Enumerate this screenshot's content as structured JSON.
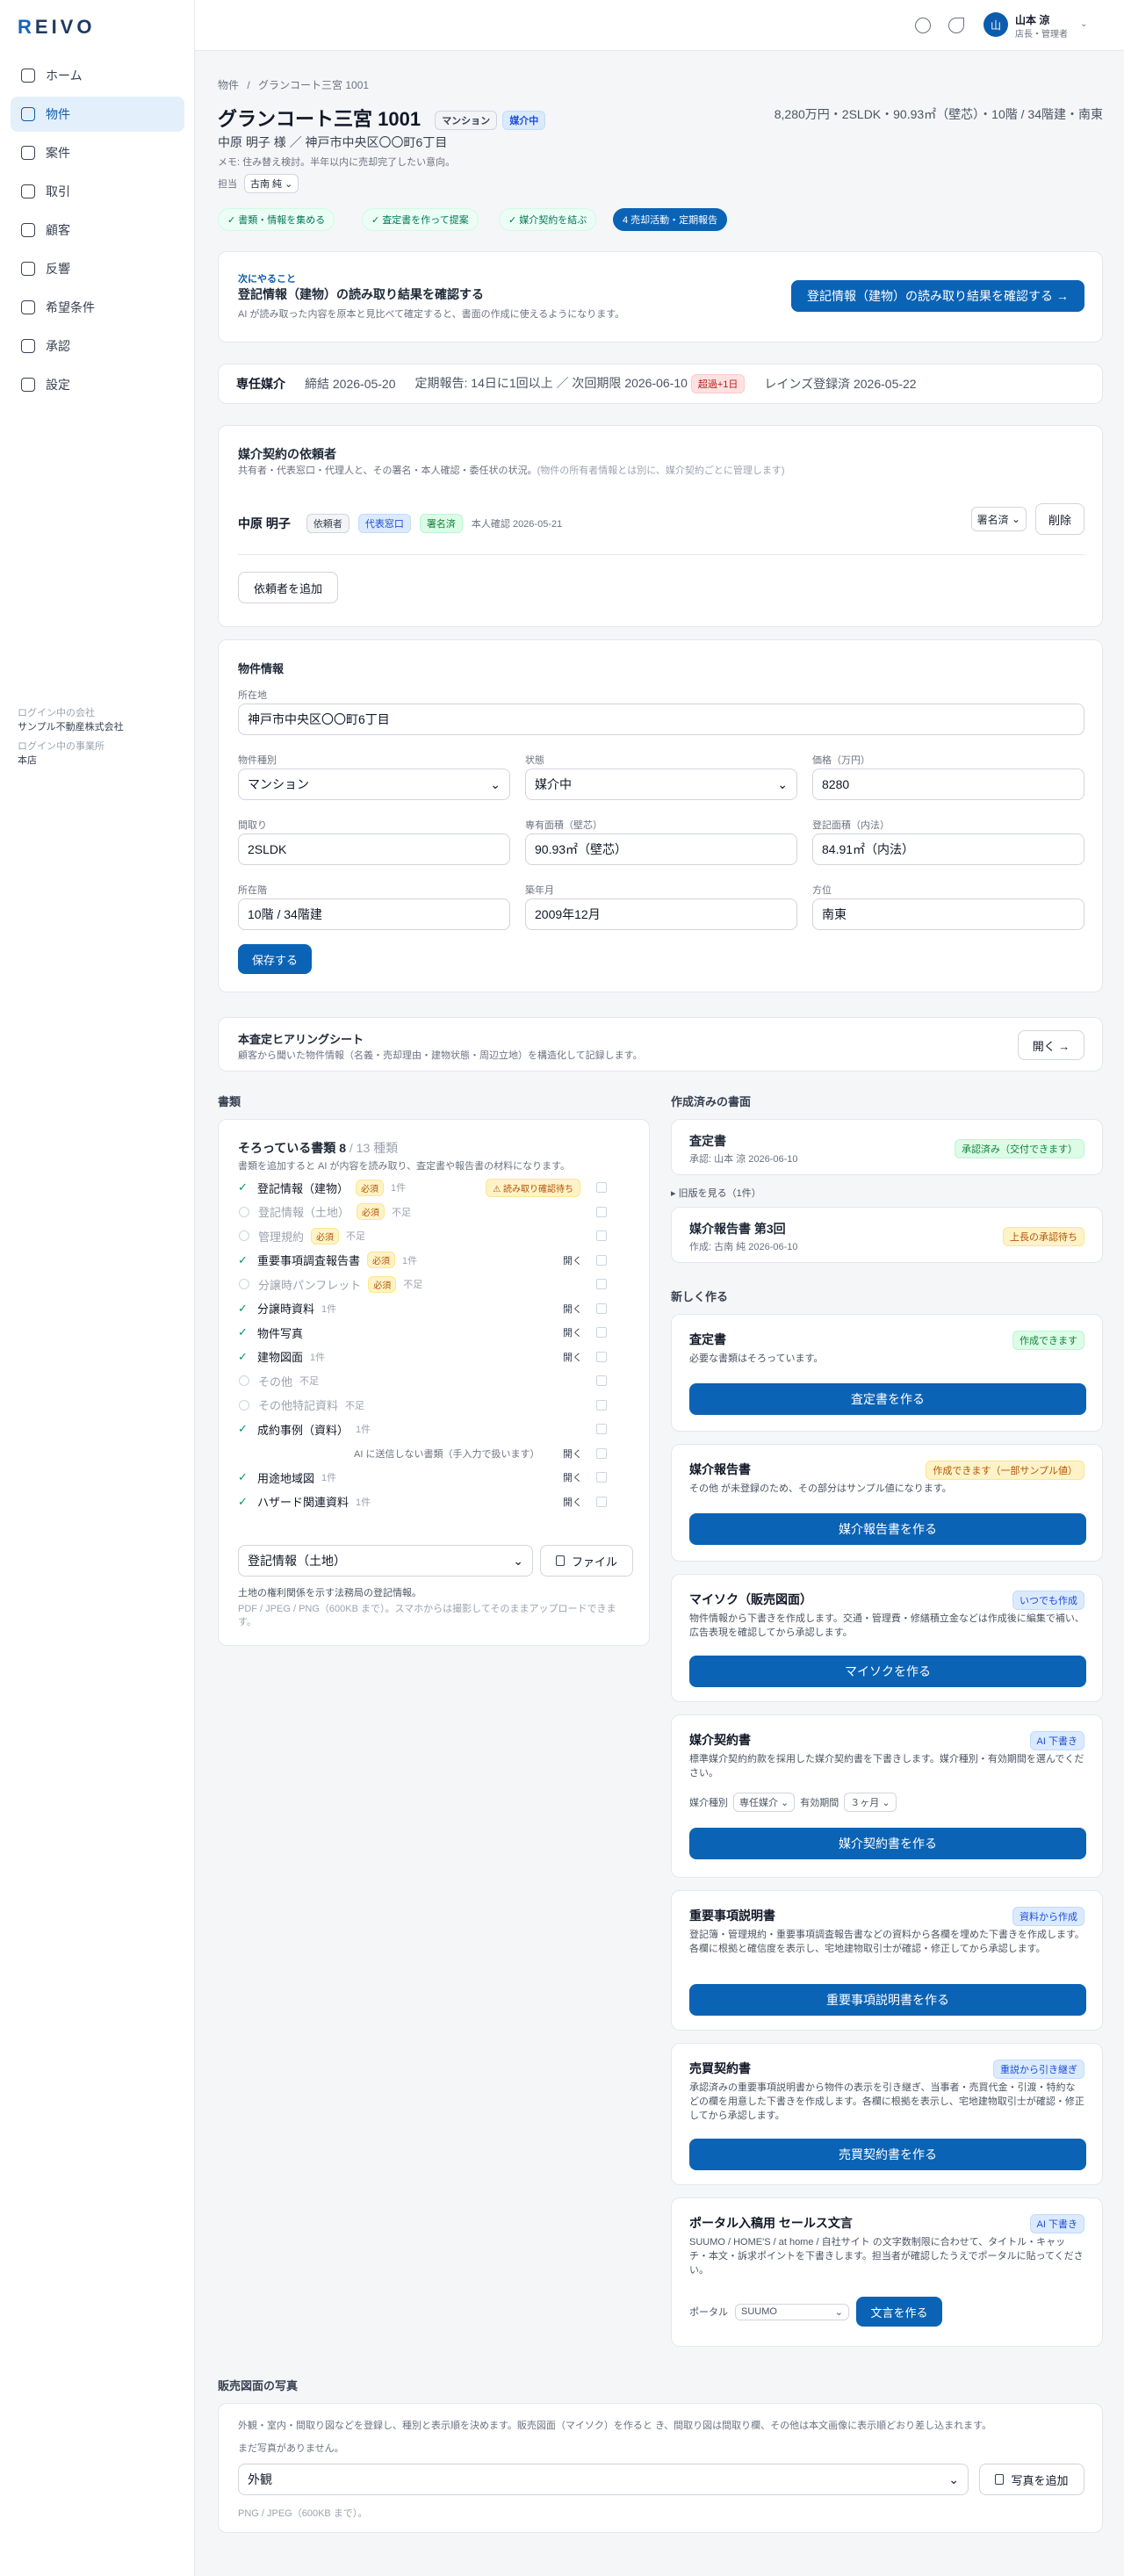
{
  "app": {
    "logo": "REIVO"
  },
  "sidebar": {
    "items": [
      {
        "label": "ホーム",
        "icon": "home-icon"
      },
      {
        "label": "物件",
        "icon": "building-icon",
        "active": true
      },
      {
        "label": "案件",
        "icon": "briefcase-icon"
      },
      {
        "label": "取引",
        "icon": "document-icon"
      },
      {
        "label": "顧客",
        "icon": "users-icon"
      },
      {
        "label": "反響",
        "icon": "inbox-icon"
      },
      {
        "label": "希望条件",
        "icon": "target-icon"
      },
      {
        "label": "承認",
        "icon": "check-square-icon"
      },
      {
        "label": "設定",
        "icon": "gear-icon"
      }
    ],
    "company_label": "ログイン中の会社",
    "company": "サンプル不動産株式会社",
    "office_label": "ログイン中の事業所",
    "office": "本店"
  },
  "user": {
    "initial": "山",
    "name": "山本 涼",
    "role": "店長・管理者"
  },
  "breadcrumb": {
    "root": "物件",
    "sep": "/",
    "current": "グランコート三宮 1001"
  },
  "property": {
    "name": "グランコート三宮 1001",
    "type_tag": "マンション",
    "status_tag": "媒介中",
    "summary": "8,280万円・2SLDK・90.93㎡（壁芯）・10階 / 34階建・南東",
    "owner_line": "中原 明子 様 ／ 神戸市中央区〇〇町6丁目",
    "memo": "メモ: 住み替え検討。半年以内に売却完了したい意向。",
    "assignee_label": "担当",
    "assignee": "古南 純"
  },
  "steps": [
    "✓ 書類・情報を集める",
    "✓ 査定書を作って提案",
    "✓ 媒介契約を結ぶ",
    "4 売却活動・定期報告"
  ],
  "next": {
    "label": "次にやること",
    "title": "登記情報（建物）の読み取り結果を確認する",
    "desc": "AI が読み取った内容を原本と見比べて確定すると、書面の作成に使えるようになります。",
    "button": "登記情報（建物）の読み取り結果を確認する →"
  },
  "mediation": {
    "type": "専任媒介",
    "signed": "締結 2026-05-20",
    "report": "定期報告: 14日に1回以上 ／ 次回期限 2026-06-10",
    "overdue": "超過+1日",
    "reins": "レインズ登録済 2026-05-22"
  },
  "clients": {
    "title": "媒介契約の依頼者",
    "desc": "共有者・代表窓口・代理人と、その署名・本人確認・委任状の状況。",
    "desc_note": "(物件の所有者情報とは別に、媒介契約ごとに管理します)",
    "name": "中原 明子",
    "role": "依頼者",
    "rep": "代表窓口",
    "signed": "署名済",
    "id_check": "本人確認 2026-05-21",
    "select": "署名済",
    "delete": "削除",
    "add": "依頼者を追加"
  },
  "info": {
    "title": "物件情報",
    "address_label": "所在地",
    "address": "神戸市中央区〇〇町6丁目",
    "kind_label": "物件種別",
    "kind": "マンション",
    "state_label": "状態",
    "state": "媒介中",
    "price_label": "価格（万円）",
    "price": "8280",
    "layout_label": "間取り",
    "layout": "2SLDK",
    "area_label": "専有面積（壁芯）",
    "area": "90.93㎡（壁芯）",
    "reg_area_label": "登記面積（内法）",
    "reg_area": "84.91㎡（内法）",
    "floor_label": "所在階",
    "floor": "10階 / 34階建",
    "built_label": "築年月",
    "built": "2009年12月",
    "dir_label": "方位",
    "dir": "南東",
    "save": "保存する"
  },
  "hearing": {
    "title": "本査定ヒアリングシート",
    "desc": "顧客から聞いた物件情報（名義・売却理由・建物状態・周辺立地）を構造化して記録します。",
    "button": "開く →"
  },
  "docs": {
    "section": "書類",
    "title": "そろっている書類 8",
    "total": "/ 13 種類",
    "desc": "書類を追加すると AI が内容を読み取り、査定書や報告書の材料になります。",
    "rows": [
      {
        "name": "登記情報（建物）",
        "ok": true,
        "req": "必須",
        "count": "1件",
        "warn": "⚠ 読み取り確認待ち"
      },
      {
        "name": "登記情報（土地）",
        "ok": false,
        "req": "必須",
        "count": "不足"
      },
      {
        "name": "管理規約",
        "ok": false,
        "req": "必須",
        "count": "不足"
      },
      {
        "name": "重要事項調査報告書",
        "ok": true,
        "req": "必須",
        "count": "1件",
        "open": "開く"
      },
      {
        "name": "分譲時パンフレット",
        "ok": false,
        "req": "必須",
        "count": "不足"
      },
      {
        "name": "分譲時資料",
        "ok": true,
        "count": "1件",
        "open": "開く"
      },
      {
        "name": "物件写真",
        "ok": true,
        "open": "開く"
      },
      {
        "name": "建物図面",
        "ok": true,
        "count": "1件",
        "open": "開く"
      },
      {
        "name": "その他",
        "ok": false,
        "count": "不足"
      },
      {
        "name": "その他特記資料",
        "ok": false,
        "count": "不足"
      },
      {
        "name": "成約事例（資料）",
        "ok": true,
        "count": "1件"
      },
      {
        "name": "AI に送信しない書類（手入力で扱います）",
        "sub": true,
        "open": "開く"
      },
      {
        "name": "用途地域図",
        "ok": true,
        "count": "1件",
        "open": "開く"
      },
      {
        "name": "ハザード関連資料",
        "ok": true,
        "count": "1件",
        "open": "開く"
      }
    ],
    "select": "登記情報（土地）",
    "file_button": "ファイル",
    "hint": "土地の権利関係を示す法務局の登記情報。",
    "formats": "PDF / JPEG / PNG（600KB まで）。スマホからは撮影してそのままアップロードできます。"
  },
  "created": {
    "section": "作成済みの書面",
    "items": [
      {
        "title": "査定書",
        "meta": "承認: 山本 涼 2026-06-10",
        "tag": "承認済み（交付できます）"
      },
      {
        "title": "媒介報告書 第3回",
        "meta": "作成: 古南 純 2026-06-10",
        "tag": "上長の承認待ち"
      }
    ],
    "old": "▸ 旧版を見る（1件）"
  },
  "create": {
    "section": "新しく作る",
    "items": [
      {
        "title": "査定書",
        "tag": "作成できます",
        "desc": "必要な書類はそろっています。",
        "button": "査定書を作る"
      },
      {
        "title": "媒介報告書",
        "tag": "作成できます（一部サンプル値）",
        "desc": "その他 が未登録のため、その部分はサンプル値になります。",
        "button": "媒介報告書を作る"
      },
      {
        "title": "マイソク（販売図面）",
        "tag": "いつでも作成",
        "desc": "物件情報から下書きを作成します。交通・管理費・修繕積立金などは作成後に編集で補い、広告表現を確認してから承認します。",
        "button": "マイソクを作る"
      },
      {
        "title": "媒介契約書",
        "tag": "AI 下書き",
        "desc": "標準媒介契約約款を採用した媒介契約書を下書きします。媒介種別・有効期間を選んでください。",
        "button": "媒介契約書を作る",
        "f1": "媒介種別",
        "v1": "専任媒介",
        "f2": "有効期間",
        "v2": "３ヶ月"
      },
      {
        "title": "重要事項説明書",
        "tag": "資料から作成",
        "desc": "登記簿・管理規約・重要事項調査報告書などの資料から各欄を埋めた下書きを作成します。各欄に根拠と確信度を表示し、宅地建物取引士が確認・修正してから承認します。",
        "button": "重要事項説明書を作る"
      },
      {
        "title": "売買契約書",
        "tag": "重説から引き継ぎ",
        "desc": "承認済みの重要事項説明書から物件の表示を引き継ぎ、当事者・売買代金・引渡・特約などの欄を用意した下書きを作成します。各欄に根拠を表示し、宅地建物取引士が確認・修正してから承認します。",
        "button": "売買契約書を作る"
      },
      {
        "title": "ポータル入稿用 セールス文言",
        "tag": "AI 下書き",
        "desc": "SUUMO / HOME'S / at home / 自社サイト の文字数制限に合わせて、タイトル・キャッチ・本文・訴求ポイントを下書きします。担当者が確認したうえでポータルに貼ってください。",
        "button": "文言を作る",
        "f1": "ポータル",
        "v1": "SUUMO"
      }
    ]
  },
  "photos": {
    "section": "販売図面の写真",
    "desc": "外観・室内・間取り図などを登録し、種別と表示順を決めます。販売図面（マイソク）を作ると き、間取り図は間取り欄、その他は本文画像に表示順どおり差し込まれます。",
    "empty": "まだ写真がありません。",
    "select": "外観",
    "button": "写真を追加",
    "formats": "PNG / JPEG（600KB まで）。"
  }
}
